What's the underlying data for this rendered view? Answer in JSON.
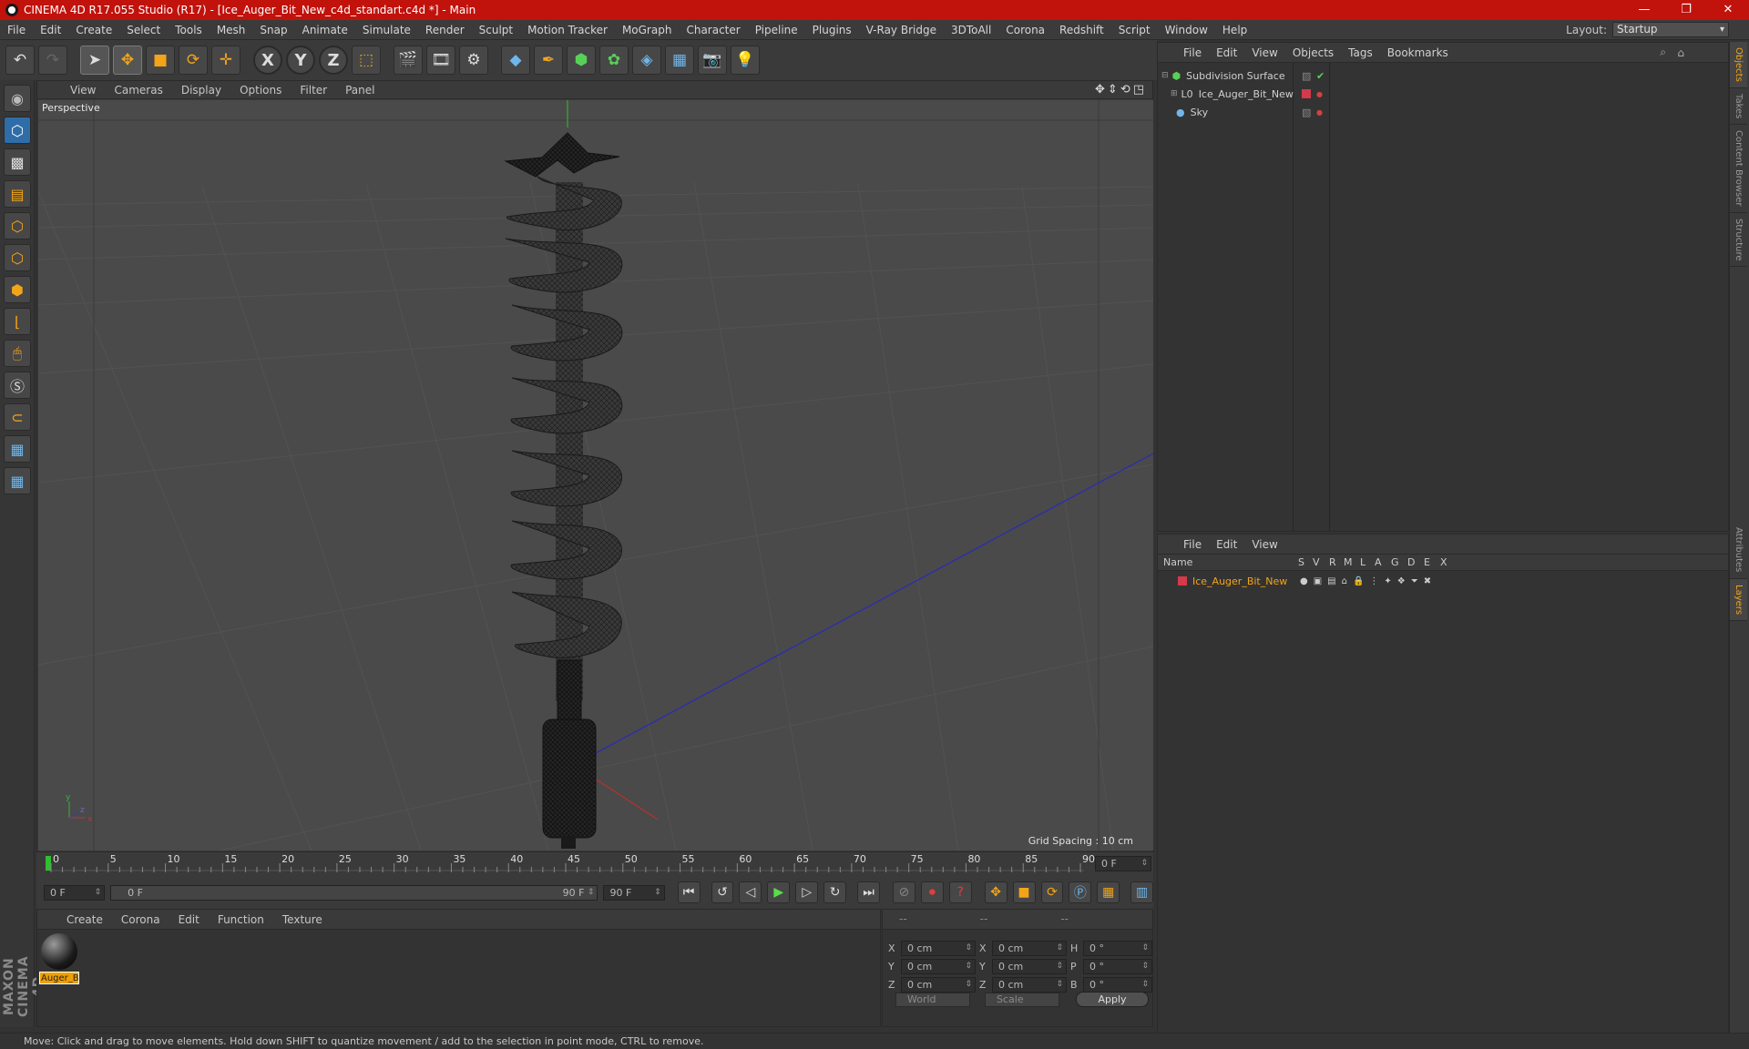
{
  "title": "CINEMA 4D R17.055 Studio (R17) - [Ice_Auger_Bit_New_c4d_standart.c4d *] - Main",
  "window_buttons": {
    "minimize": "—",
    "restore": "❐",
    "close": "✕"
  },
  "menu": [
    "File",
    "Edit",
    "Create",
    "Select",
    "Tools",
    "Mesh",
    "Snap",
    "Animate",
    "Simulate",
    "Render",
    "Sculpt",
    "Motion Tracker",
    "MoGraph",
    "Character",
    "Pipeline",
    "Plugins",
    "V-Ray Bridge",
    "3DToAll",
    "Corona",
    "Redshift",
    "Script",
    "Window",
    "Help"
  ],
  "layout": {
    "label": "Layout:",
    "value": "Startup"
  },
  "viewport": {
    "menu": [
      "View",
      "Cameras",
      "Display",
      "Options",
      "Filter",
      "Panel"
    ],
    "label": "Perspective",
    "grid_spacing": "Grid Spacing : 10 cm",
    "nav_icons": "✥⇕⟲◳"
  },
  "timeline": {
    "ticks": [
      "0",
      "5",
      "10",
      "15",
      "20",
      "25",
      "30",
      "35",
      "40",
      "45",
      "50",
      "55",
      "60",
      "65",
      "70",
      "75",
      "80",
      "85",
      "90"
    ],
    "current_frame": "0 F"
  },
  "transport": {
    "start": "0 F",
    "range_start": "0 F",
    "range_end": "90 F",
    "end": "90 F"
  },
  "material_panel": {
    "menu": [
      "Create",
      "Corona",
      "Edit",
      "Function",
      "Texture"
    ],
    "material_name": "Auger_B"
  },
  "coords": {
    "headers": [
      "--",
      "--",
      "--"
    ],
    "rows": [
      {
        "k1": "X",
        "v1": "0 cm",
        "k2": "X",
        "v2": "0 cm",
        "k3": "H",
        "v3": "0 °"
      },
      {
        "k1": "Y",
        "v1": "0 cm",
        "k2": "Y",
        "v2": "0 cm",
        "k3": "P",
        "v3": "0 °"
      },
      {
        "k1": "Z",
        "v1": "0 cm",
        "k2": "Z",
        "v2": "0 cm",
        "k3": "B",
        "v3": "0 °"
      }
    ],
    "world": "World",
    "scale": "Scale",
    "apply": "Apply"
  },
  "object_manager": {
    "menu": [
      "File",
      "Edit",
      "View",
      "Objects",
      "Tags",
      "Bookmarks"
    ],
    "objects": [
      {
        "name": "Subdivision Surface",
        "icon": "subdivision-icon"
      },
      {
        "name": "Ice_Auger_Bit_New",
        "icon": "null-object-icon"
      },
      {
        "name": "Sky",
        "icon": "sky-icon"
      }
    ]
  },
  "layer_manager": {
    "menu": [
      "File",
      "Edit",
      "View"
    ],
    "columns": [
      "Name",
      "S",
      "V",
      "R",
      "M",
      "L",
      "A",
      "G",
      "D",
      "E",
      "X"
    ],
    "layers": [
      {
        "name": "Ice_Auger_Bit_New"
      }
    ]
  },
  "right_tabs": [
    "Objects",
    "Takes",
    "Content Browser",
    "Structure",
    "Attributes",
    "Layers"
  ],
  "status": "Move: Click and drag to move elements. Hold down SHIFT to quantize movement / add to the selection in point mode, CTRL to remove.",
  "branding": "MAXON CINEMA 4D",
  "colors": {
    "title_bar": "#c1120c",
    "accent": "#f3a419",
    "selection": "#2e6da8"
  }
}
